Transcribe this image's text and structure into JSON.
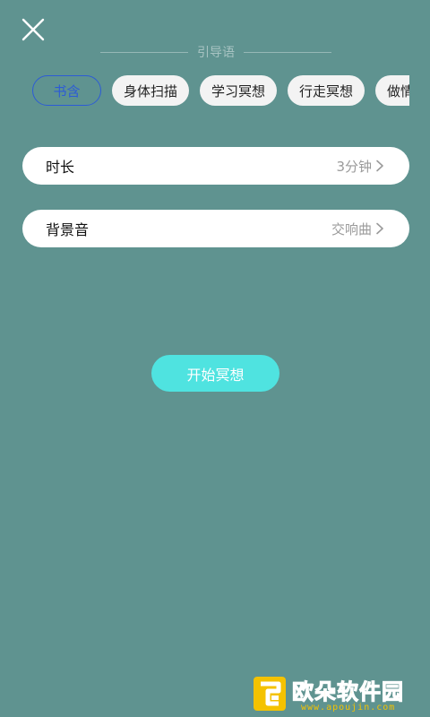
{
  "header": {
    "section_label": "引导语"
  },
  "chips": [
    {
      "label": "书含",
      "selected": true
    },
    {
      "label": "身体扫描",
      "selected": false
    },
    {
      "label": "学习冥想",
      "selected": false
    },
    {
      "label": "行走冥想",
      "selected": false
    },
    {
      "label": "做情",
      "selected": false
    }
  ],
  "settings": {
    "duration": {
      "title": "时长",
      "value": "3分钟"
    },
    "background_sound": {
      "title": "背景音",
      "value": "交响曲"
    }
  },
  "start_button": {
    "label": "开始冥想"
  },
  "watermark": {
    "title": "欧朵软件园",
    "url": "www.apoujin.com"
  },
  "colors": {
    "background": "#5f9390",
    "accent": "#4fe3e0",
    "selected_chip": "#2c5bd6",
    "watermark": "#f4c200"
  }
}
